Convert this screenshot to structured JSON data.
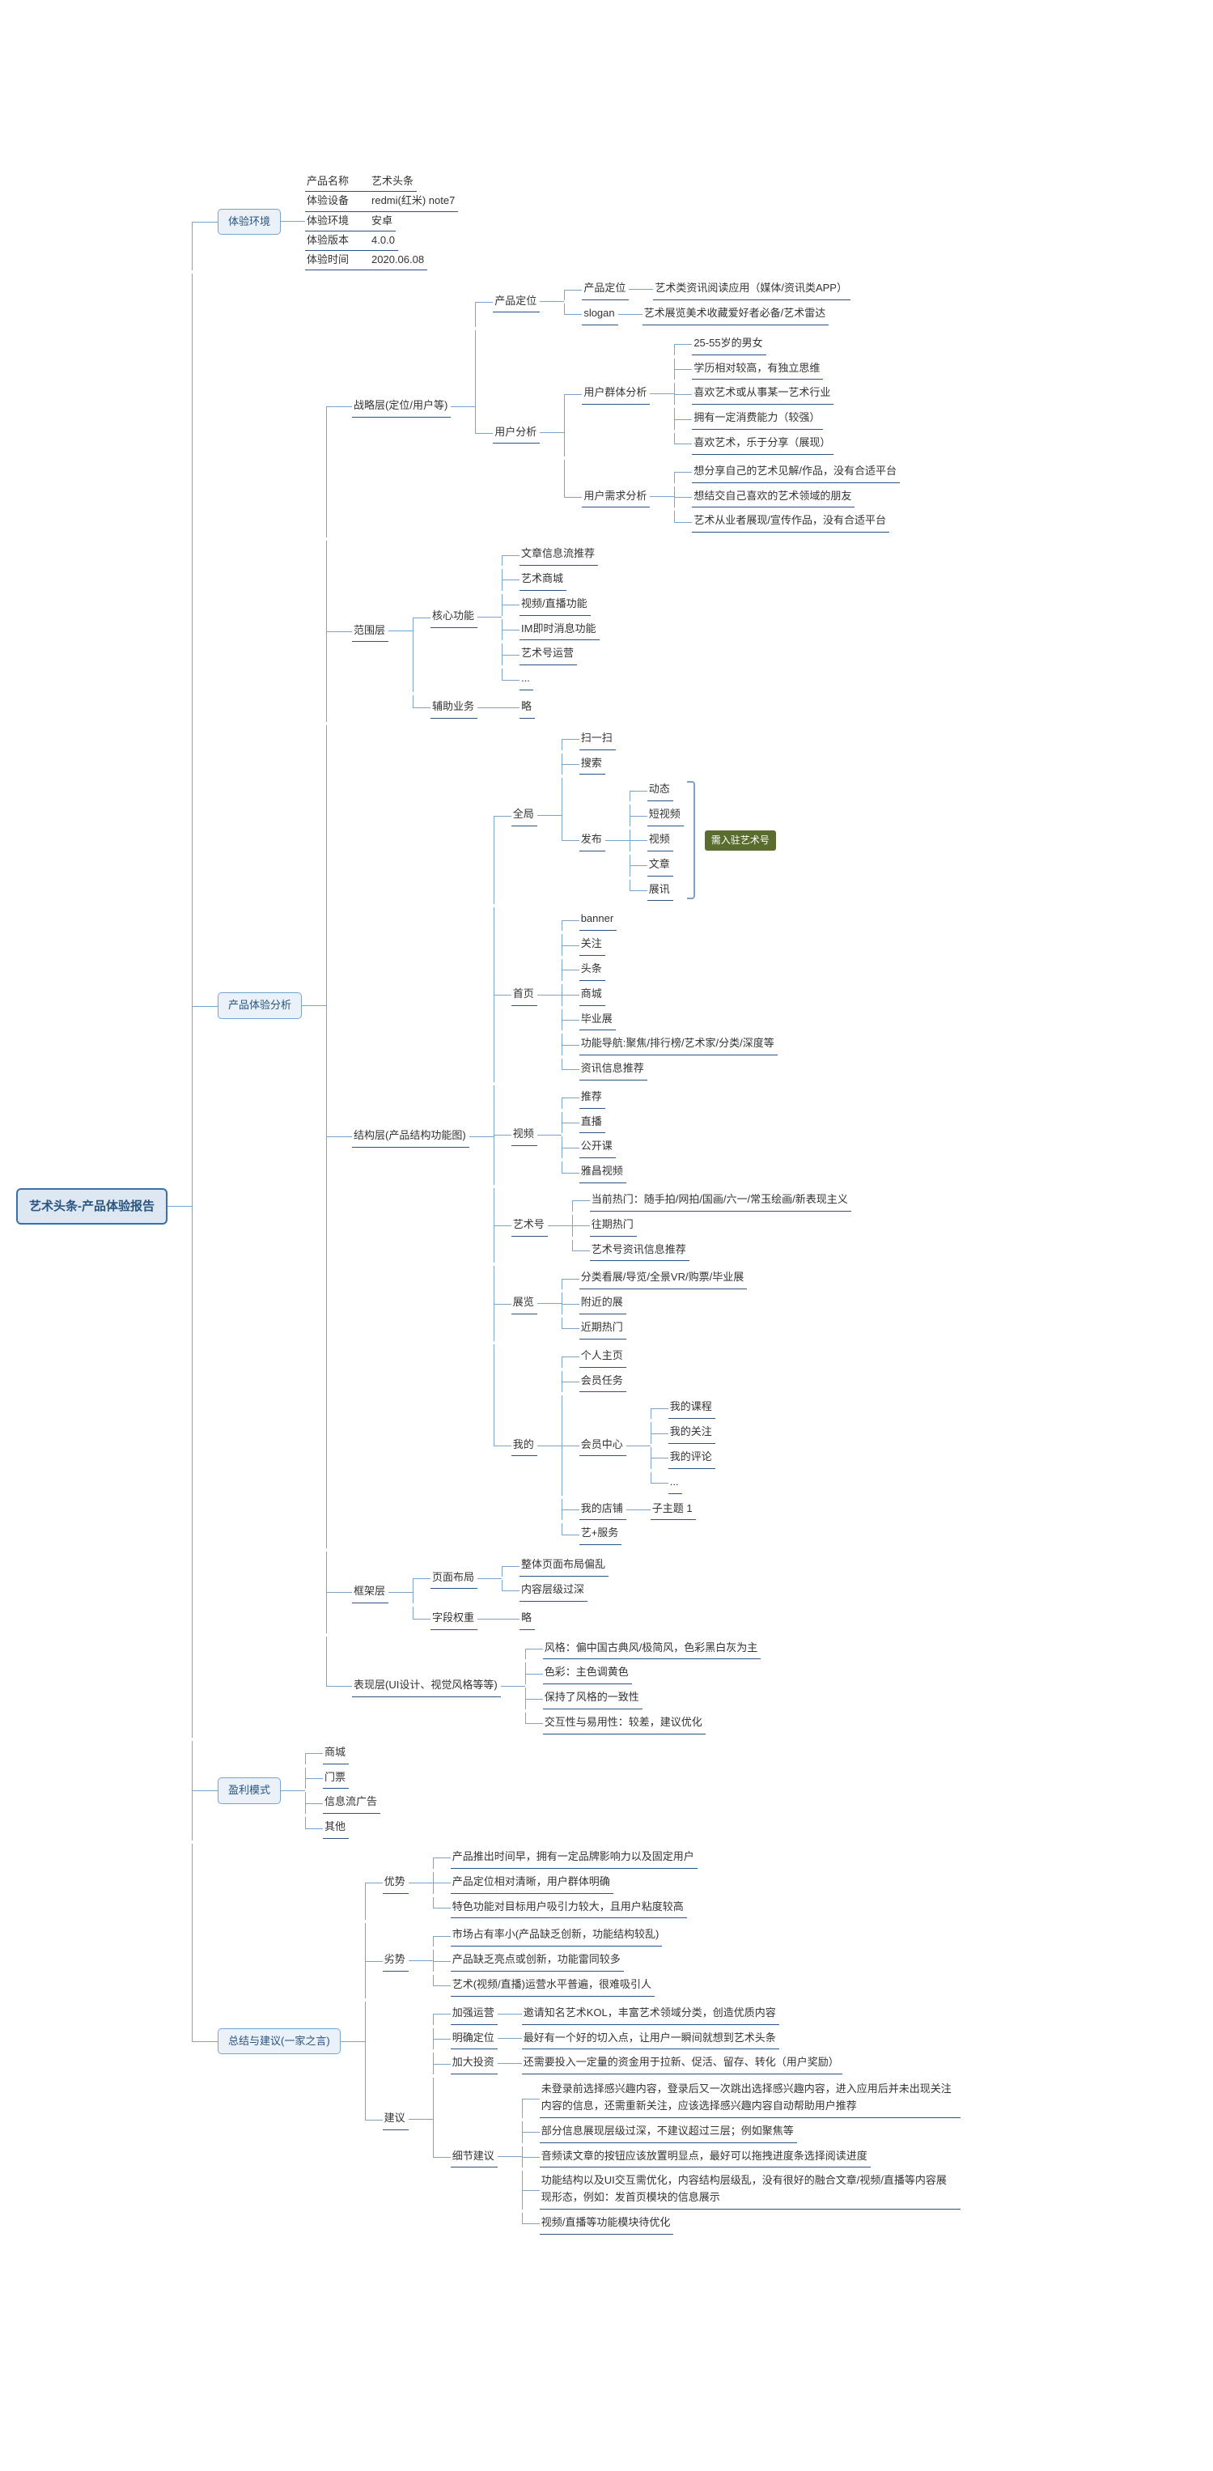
{
  "root": "艺术头条-产品体验报告",
  "env": {
    "title": "体验环境",
    "rows": [
      {
        "k": "产品名称",
        "v": "艺术头条"
      },
      {
        "k": "体验设备",
        "v": "redmi(红米) note7"
      },
      {
        "k": "体验环境",
        "v": "安卓"
      },
      {
        "k": "体验版本",
        "v": "4.0.0"
      },
      {
        "k": "体验时间",
        "v": "2020.06.08"
      }
    ]
  },
  "analysis": {
    "title": "产品体验分析",
    "strategy": {
      "title": "战略层(定位/用户等)",
      "positioning": {
        "title": "产品定位",
        "rows": [
          {
            "k": "产品定位",
            "v": "艺术类资讯阅读应用（媒体/资讯类APP）"
          },
          {
            "k": "slogan",
            "v": "艺术展览美术收藏爱好者必备/艺术雷达"
          }
        ]
      },
      "users": {
        "title": "用户分析",
        "group": {
          "title": "用户群体分析",
          "items": [
            "25-55岁的男女",
            "学历相对较高，有独立思维",
            "喜欢艺术或从事某一艺术行业",
            "拥有一定消费能力（较强）",
            "喜欢艺术，乐于分享（展现）"
          ]
        },
        "needs": {
          "title": "用户需求分析",
          "items": [
            "想分享自己的艺术见解/作品，没有合适平台",
            "想结交自己喜欢的艺术领域的朋友",
            "艺术从业者展现/宣传作品，没有合适平台"
          ]
        }
      }
    },
    "scope": {
      "title": "范围层",
      "core": {
        "title": "核心功能",
        "items": [
          "文章信息流推荐",
          "艺术商城",
          "视频/直播功能",
          "IM即时消息功能",
          "艺术号运营",
          "..."
        ]
      },
      "aux": {
        "title": "辅助业务",
        "items": [
          "略"
        ]
      }
    },
    "structure": {
      "title": "结构层(产品结构功能图)",
      "global": {
        "title": "全局",
        "items0": [
          "扫一扫",
          "搜索"
        ],
        "publish": {
          "title": "发布",
          "items": [
            "动态",
            "短视频",
            "视频",
            "文章",
            "展讯"
          ],
          "callout": "需入驻艺术号"
        }
      },
      "home": {
        "title": "首页",
        "items": [
          "banner",
          "关注",
          "头条",
          "商城",
          "毕业展",
          "功能导航:聚焦/排行榜/艺术家/分类/深度等",
          "资讯信息推荐"
        ]
      },
      "video": {
        "title": "视频",
        "items": [
          "推荐",
          "直播",
          "公开课",
          "雅昌视频"
        ]
      },
      "artnum": {
        "title": "艺术号",
        "items": [
          "当前热门：随手拍/网拍/国画/六一/常玉绘画/新表现主义",
          "往期热门",
          "艺术号资讯信息推荐"
        ]
      },
      "exhibit": {
        "title": "展览",
        "items": [
          "分类看展/导览/全景VR/购票/毕业展",
          "附近的展",
          "近期热门"
        ]
      },
      "mine": {
        "title": "我的",
        "items0": [
          "个人主页",
          "会员任务"
        ],
        "member": {
          "title": "会员中心",
          "items": [
            "我的课程",
            "我的关注",
            "我的评论",
            "..."
          ]
        },
        "items1": [
          {
            "k": "我的店铺",
            "v": "子主题 1"
          },
          {
            "k": "艺+服务",
            "v": ""
          }
        ]
      }
    },
    "frame": {
      "title": "框架层",
      "layout": {
        "title": "页面布局",
        "items": [
          "整体页面布局偏乱",
          "内容层级过深"
        ]
      },
      "weight": {
        "title": "字段权重",
        "items": [
          "略"
        ]
      }
    },
    "surface": {
      "title": "表现层(UI设计、视觉风格等等)",
      "items": [
        "风格：偏中国古典风/极简风，色彩黑白灰为主",
        "色彩：主色调黄色",
        "保持了风格的一致性",
        "交互性与易用性：较差，建议优化"
      ]
    }
  },
  "profit": {
    "title": "盈利模式",
    "items": [
      "商城",
      "门票",
      "信息流广告",
      "其他"
    ]
  },
  "summary": {
    "title": "总结与建议(一家之言)",
    "adv": {
      "title": "优势",
      "items": [
        "产品推出时间早，拥有一定品牌影响力以及固定用户",
        "产品定位相对清晰，用户群体明确",
        "特色功能对目标用户吸引力较大，且用户粘度较高"
      ]
    },
    "dis": {
      "title": "劣势",
      "items": [
        "市场占有率小(产品缺乏创新，功能结构较乱)",
        "产品缺乏亮点或创新，功能雷同较多",
        "艺术(视频/直播)运营水平普遍，很难吸引人"
      ]
    },
    "sug": {
      "title": "建议",
      "rows": [
        {
          "k": "加强运营",
          "v": "邀请知名艺术KOL，丰富艺术领域分类，创造优质内容"
        },
        {
          "k": "明确定位",
          "v": "最好有一个好的切入点，让用户一瞬间就想到艺术头条"
        },
        {
          "k": "加大投资",
          "v": "还需要投入一定量的资金用于拉新、促活、留存、转化（用户奖励）"
        }
      ],
      "detail": {
        "title": "细节建议",
        "items": [
          "未登录前选择感兴趣内容，登录后又一次跳出选择感兴趣内容，进入应用后并未出现关注内容的信息，还需重新关注，应该选择感兴趣内容自动帮助用户推荐",
          "部分信息展现层级过深，不建议超过三层；例如聚焦等",
          "音频读文章的按钮应该放置明显点，最好可以拖拽进度条选择阅读进度",
          "功能结构以及UI交互需优化，内容结构层级乱，没有很好的融合文章/视频/直播等内容展现形态，例如：发首页模块的信息展示",
          "视频/直播等功能模块待优化"
        ]
      }
    }
  }
}
